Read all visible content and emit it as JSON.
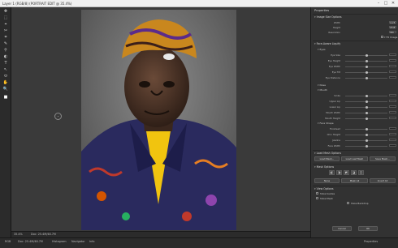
{
  "window": {
    "title": "Layer 1 (RGB/8) (PORTRAIT EDIT @ 35.4%)",
    "minimize": "–",
    "maximize": "□",
    "close": "✕"
  },
  "tools": [
    "✥",
    "⬚",
    "⌖",
    "✂",
    "⌗",
    "✎",
    "⚲",
    "◐",
    "T",
    "↖",
    "⬭",
    "✋",
    "🔍",
    "■"
  ],
  "canvas": {
    "zoom": "35.4%",
    "doc_info": "Doc: 25.4M/48.7M"
  },
  "panel": {
    "title": "Properties",
    "sec1": {
      "title": "Image Size Options",
      "rows": [
        {
          "label": "Width",
          "value": "1428"
        },
        {
          "label": "Height",
          "value": "2048"
        },
        {
          "label": "Resolution",
          "value": "300"
        }
      ],
      "extra_label": "Fit Image"
    },
    "sec2": {
      "title": "Face-Aware Liquify",
      "eyes": {
        "title": "Eyes",
        "rows": [
          {
            "label": "Eye Size",
            "k": 0.5
          },
          {
            "label": "Eye Height",
            "k": 0.5
          },
          {
            "label": "Eye Width",
            "k": 0.5
          },
          {
            "label": "Eye Tilt",
            "k": 0.5
          },
          {
            "label": "Eye Distance",
            "k": 0.5
          }
        ]
      },
      "nose": {
        "title": "Nose"
      },
      "mouth": {
        "title": "Mouth",
        "rows": [
          {
            "label": "Smile",
            "k": 0.5
          },
          {
            "label": "Upper Lip",
            "k": 0.5
          },
          {
            "label": "Lower Lip",
            "k": 0.5
          },
          {
            "label": "Mouth Width",
            "k": 0.5
          },
          {
            "label": "Mouth Height",
            "k": 0.5
          }
        ]
      },
      "face": {
        "title": "Face Shape",
        "rows": [
          {
            "label": "Forehead",
            "k": 0.5
          },
          {
            "label": "Chin Height",
            "k": 0.5
          },
          {
            "label": "Jawline",
            "k": 0.5
          },
          {
            "label": "Face Width",
            "k": 0.5
          }
        ]
      }
    },
    "sec3": {
      "title": "Load Mesh Options",
      "buttons": [
        "Load Mesh...",
        "Load Last Mesh",
        "Save Mesh..."
      ]
    },
    "sec4": {
      "title": "Mask Options",
      "buttons": [
        "None",
        "Mask All",
        "Invert All"
      ]
    },
    "sec5": {
      "title": "View Options",
      "show_guides": "Show Guides",
      "show_mesh": "Show Mesh",
      "show_backdrop": "Show Backdrop"
    },
    "footer": {
      "cancel": "Cancel",
      "ok": "OK"
    }
  },
  "status": {
    "items": [
      "RGB",
      "Doc: 25.4M/48.7M",
      "Histogram",
      "Navigator",
      "Info",
      "Properties"
    ]
  }
}
